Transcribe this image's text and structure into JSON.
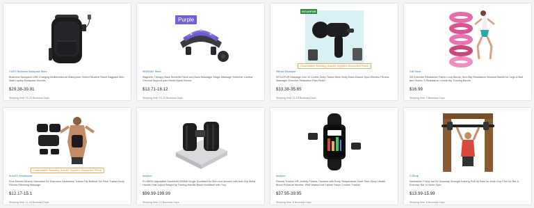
{
  "products": [
    {
      "supplier": "CUES Business Backpack Store",
      "title": "Business Backpack USB Charging Multifunctional Waterproof Oxford Student Travel Bagpack Men Male Laptop Backpack Mochila",
      "price": "$29.38-39.91",
      "shipping": "Shipping time: 15-20 Business Days",
      "image": "black-backpack",
      "badge": "",
      "tag": ""
    },
    {
      "supplier": "MORGAY Store",
      "title": "Magnetic Therapy Back Stretcher Neck and Back Massager Magic Massage Stretcher Lumbar Cervical Support pain Relief Spine Device",
      "price": "$13.71-18.12",
      "shipping": "Shipping time: 15-20 Business Days",
      "image": "back-stretcher",
      "badge": "",
      "tag": "Purple"
    },
    {
      "supplier": "Sitfufor Boutique",
      "title": "SITUOFUR Massage Gun 32 Levels Deep Tissue Neck Body Back Muscle Sport Electric Fitness Massager Exercise Relaxation Pain Relief",
      "price": "$33.38-35.65",
      "shipping": "Shipping time: 11-16 Business Days",
      "image": "massage-gun",
      "badge": "Customizable Branding | AutoDS Suppliers Discounted Prices",
      "tag": "SITUOFUR"
    },
    {
      "supplier": "DIA Store",
      "title": "3/5 Exercise Resistance Fabric Loop Bands, Non-Slip Resistance Workout Bands for Legs & Butt and Glutes, 5 Resistance Levels Hip Training Bands",
      "price": "$16.99",
      "shipping": "Shipping time: 3 Business Days",
      "image": "resistance-bands",
      "badge": "",
      "tag": ""
    },
    {
      "supplier": "AutoDS Warehouse",
      "title": "Ems Electric Muscle Stimulator for Exercises Abdominal Trainer Hip Buttock Six Pack Trainer Body Fitness Slimming Massage",
      "price": "$12.17-15.1",
      "shipping": "Shipping time: 11-16 Business Days",
      "image": "ems-stimulator",
      "badge": "Customizable Branding | AutoDS Suppliers Discounted Prices",
      "tag": ""
    },
    {
      "supplier": "amazon",
      "title": "FLYBIRD Adjustable Dumbbell,25/55lb Single Dumbbell for Men and Women with Anti-Slip Metal Handle,Fast Adjust Weight by Turning Handle,Black Dumbbell with Tray",
      "price": "$99.99-199.99",
      "shipping": "Shipping time: 10 Business Days",
      "image": "adjustable-dumbbell",
      "badge": "",
      "tag": ""
    },
    {
      "supplier": "amazon",
      "title": "Fitness Tracker HR, Activity Fitness Trackers with Body Temperature Heart Rate Sleep Health Blood Pressure Monitor, IP68 Waterproof Calorie Steps Counter Tracker",
      "price": "$37.95-39.95",
      "shipping": "Shipping time: 5 Business Days",
      "image": "fitness-tracker",
      "badge": "",
      "tag": ""
    },
    {
      "supplier": "CJDrop",
      "title": "Newhaider Pullup bar for Doorway Strength training Pull Up Bars for Multi-Grip Chin Up Bar & Exercise Bar & Home Gym",
      "price": "$13.99-15.99",
      "shipping": "Shipping time: 8 Business Days",
      "image": "pullup-bar",
      "badge": "",
      "tag": ""
    }
  ]
}
